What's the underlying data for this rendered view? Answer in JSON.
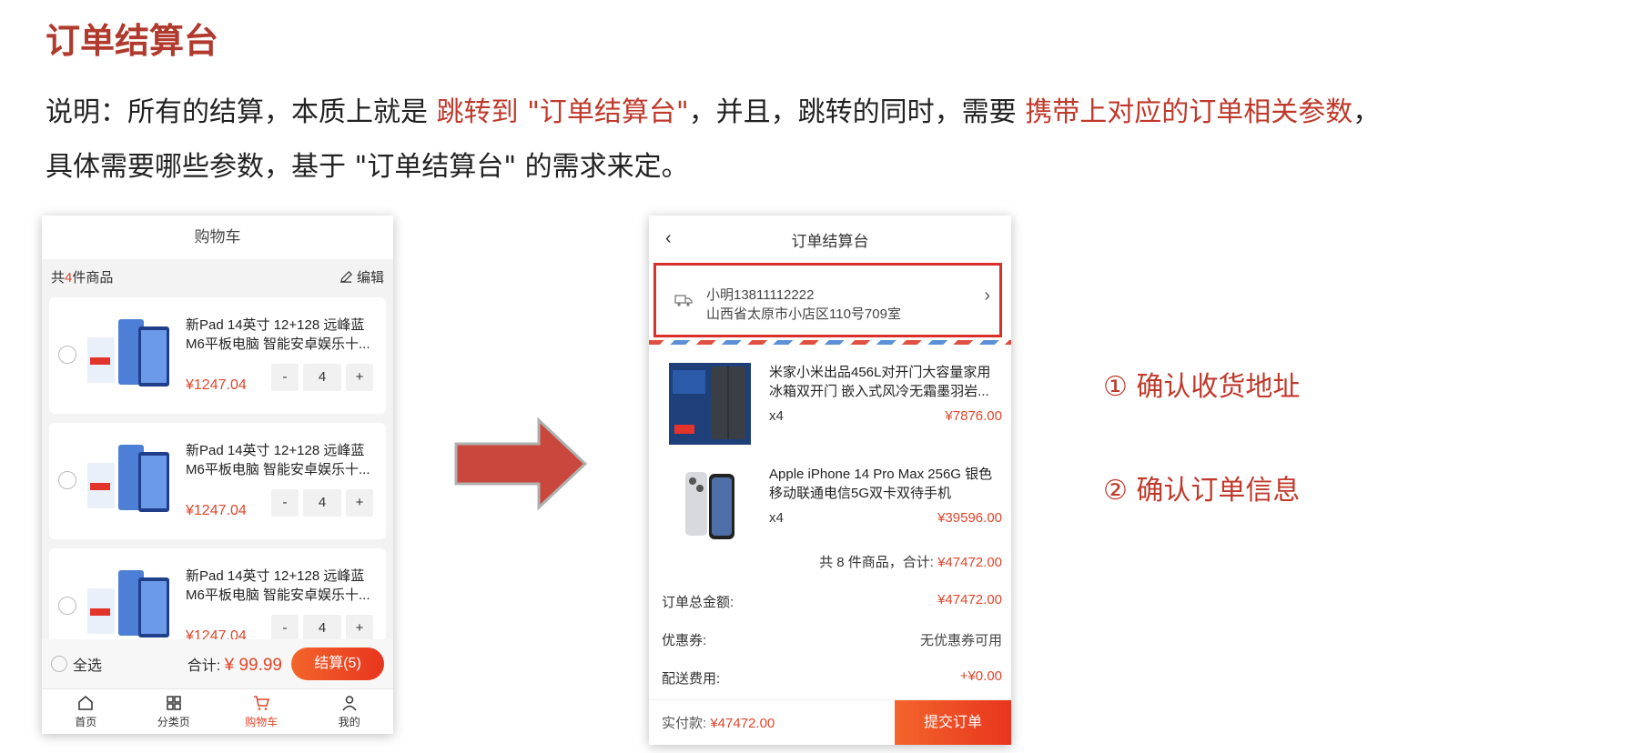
{
  "slide": {
    "title": "订单结算台",
    "desc1_a": "说明：所有的结算，本质上就是 ",
    "desc1_b": "跳转到 \"订单结算台\"",
    "desc1_c": "，并且，跳转的同时，需要 ",
    "desc1_d": "携带上对应的订单相关参数",
    "desc1_e": "，",
    "desc2": "具体需要哪些参数，基于 \"订单结算台\" 的需求来定。",
    "step1": "① 确认收货地址",
    "step2": "② 确认订单信息",
    "accent_color": "#c0392b"
  },
  "cart": {
    "title": "购物车",
    "count_prefix": "共",
    "count": "4",
    "count_suffix": "件商品",
    "edit_label": "编辑",
    "items": [
      {
        "name": "新Pad 14英寸 12+128 远峰蓝 M6平板电脑 智能安卓娱乐十...",
        "price": "¥1247.04",
        "qty": "4",
        "minus": "-",
        "plus": "+"
      },
      {
        "name": "新Pad 14英寸 12+128 远峰蓝 M6平板电脑 智能安卓娱乐十...",
        "price": "¥1247.04",
        "qty": "4",
        "minus": "-",
        "plus": "+"
      },
      {
        "name": "新Pad 14英寸 12+128 远峰蓝 M6平板电脑 智能安卓娱乐十...",
        "price": "¥1247.04",
        "qty": "4",
        "minus": "-",
        "plus": "+"
      }
    ],
    "select_all": "全选",
    "sum_label": "合计:",
    "sum_value": "¥ 99.99",
    "settle_label": "结算(5)",
    "tabs": [
      {
        "label": "首页",
        "icon": "home-icon"
      },
      {
        "label": "分类页",
        "icon": "grid-icon"
      },
      {
        "label": "购物车",
        "icon": "cart-icon"
      },
      {
        "label": "我的",
        "icon": "user-icon"
      }
    ]
  },
  "checkout": {
    "title": "订单结算台",
    "address_name": "小明13811112222",
    "address_detail": "山西省太原市小店区110号709室",
    "items": [
      {
        "name": "米家小米出品456L对开门大容量家用冰箱双开门 嵌入式风冷无霜墨羽岩...",
        "qty": "x4",
        "price": "¥7876.00"
      },
      {
        "name": "Apple iPhone 14 Pro Max 256G 银色 移动联通电信5G双卡双待手机",
        "qty": "x4",
        "price": "¥39596.00"
      }
    ],
    "total_text": "共 8 件商品，合计:",
    "total_value": "¥47472.00",
    "rows": [
      {
        "label": "订单总金额:",
        "value": "¥47472.00"
      },
      {
        "label": "优惠券:",
        "value": "无优惠券可用"
      },
      {
        "label": "配送费用:",
        "value": "+¥0.00"
      }
    ],
    "pay_label": "实付款:",
    "pay_value": "¥47472.00",
    "submit_label": "提交订单"
  }
}
